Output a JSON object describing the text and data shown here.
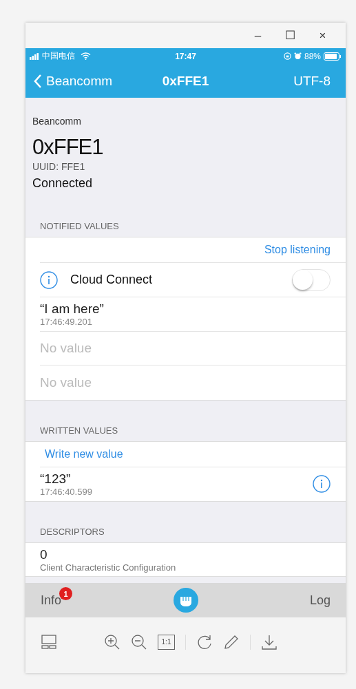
{
  "window": {
    "controls": [
      "–",
      "☐",
      "×"
    ]
  },
  "status_bar": {
    "carrier": "中国电信",
    "time": "17:47",
    "battery": "88%"
  },
  "nav": {
    "back": "Beancomm",
    "title": "0xFFE1",
    "action": "UTF-8"
  },
  "header": {
    "service": "Beancomm",
    "name": "0xFFE1",
    "uuid": "UUID: FFE1",
    "status": "Connected"
  },
  "notified": {
    "title": "NOTIFIED VALUES",
    "action": "Stop listening",
    "toggle": {
      "label": "Cloud Connect",
      "on": false
    },
    "values": [
      {
        "value": "“I am here”",
        "time": "17:46:49.201",
        "empty": false
      },
      {
        "value": "No value",
        "empty": true
      },
      {
        "value": "No value",
        "empty": true
      }
    ]
  },
  "written": {
    "title": "WRITTEN VALUES",
    "action": "Write new value",
    "values": [
      {
        "value": "“123”",
        "time": "17:46:40.599"
      }
    ]
  },
  "descriptors": {
    "title": "DESCRIPTORS",
    "items": [
      {
        "value": "0",
        "label": "Client Characteristic Configuration"
      }
    ]
  },
  "tabs": [
    {
      "label": "Info",
      "badge": "1",
      "selected": false
    },
    {
      "label": "Log",
      "selected": false
    }
  ],
  "toolbar": {
    "ratio": "1:1"
  }
}
